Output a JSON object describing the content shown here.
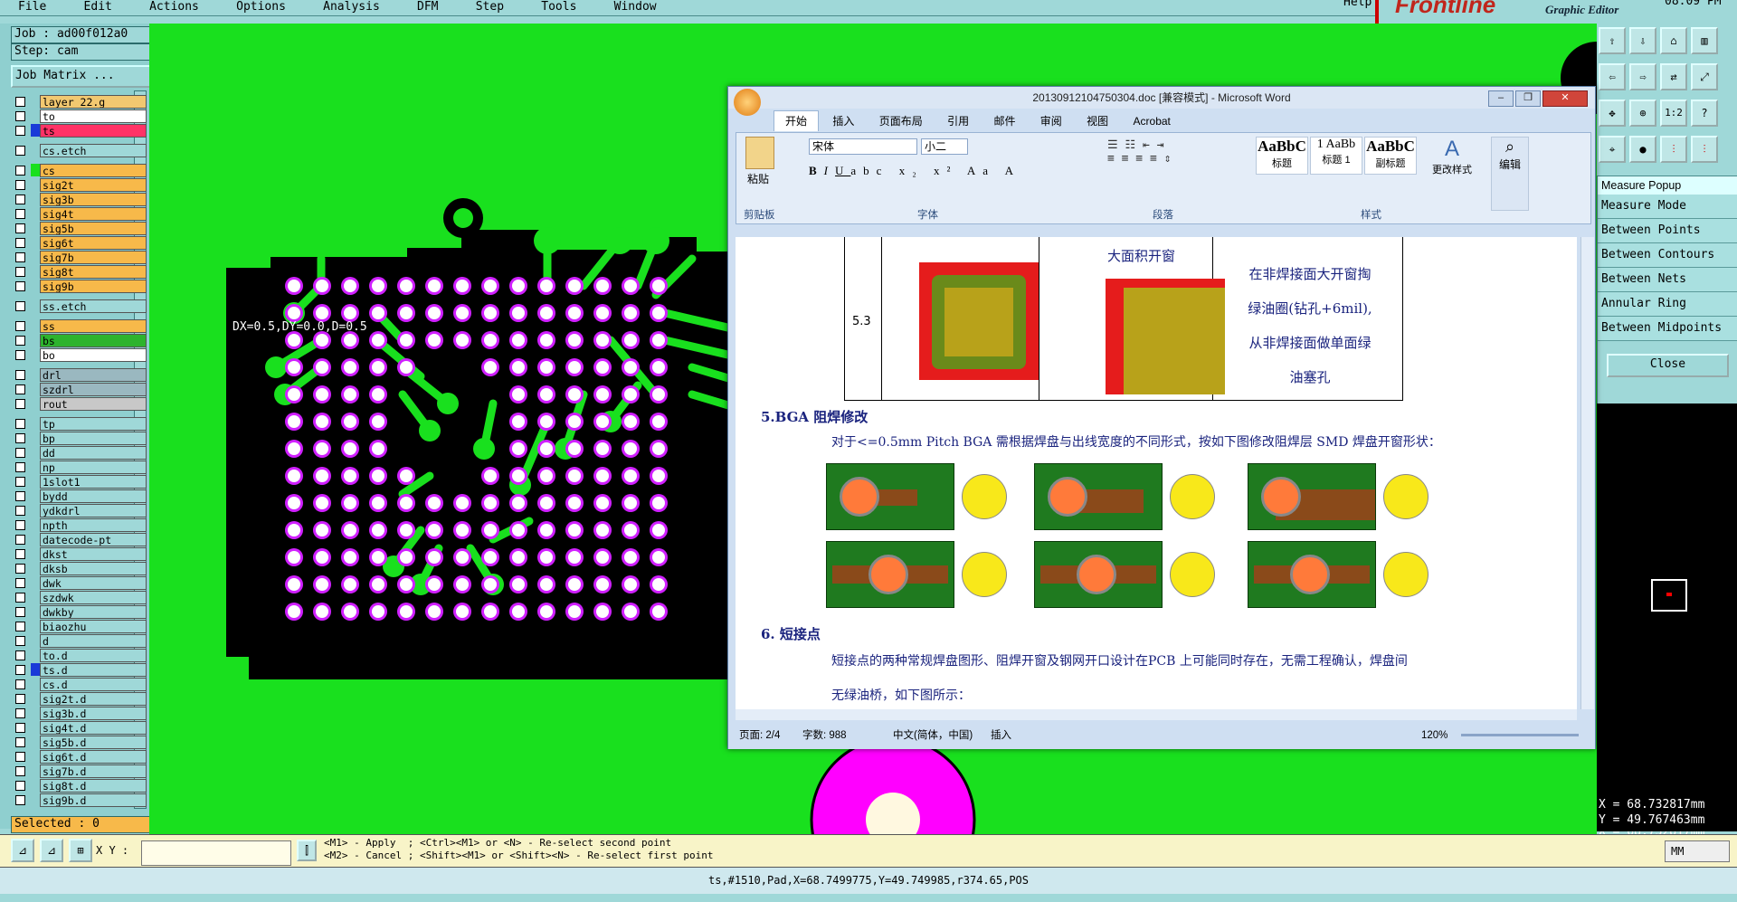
{
  "menu": [
    "File",
    "Edit",
    "Actions",
    "Options",
    "Analysis",
    "DFM",
    "Step",
    "Tools",
    "Window"
  ],
  "help": "Help",
  "brand": {
    "logo": "Frontline",
    "subtitle": "Graphic Editor",
    "clock": "08:09 PM"
  },
  "left": {
    "job": "Job : ad00f012a0",
    "step": "Step: cam",
    "job_matrix": "Job Matrix ...",
    "selected": "Selected : 0"
  },
  "layers": [
    {
      "name": "layer_22.g",
      "color": "#f2c870"
    },
    {
      "name": "to",
      "color": "#ffffff"
    },
    {
      "name": "ts",
      "color": "#ff3366",
      "swatch": "#1a3ad8"
    },
    {
      "gap": true
    },
    {
      "name": "cs.etch",
      "color": "#9fd8d8"
    },
    {
      "gap": true
    },
    {
      "name": "cs",
      "color": "#f7b94a",
      "swatch": "#19e01e"
    },
    {
      "name": "sig2t",
      "color": "#f7b94a"
    },
    {
      "name": "sig3b",
      "color": "#f7b94a"
    },
    {
      "name": "sig4t",
      "color": "#f7b94a"
    },
    {
      "name": "sig5b",
      "color": "#f7b94a"
    },
    {
      "name": "sig6t",
      "color": "#f7b94a"
    },
    {
      "name": "sig7b",
      "color": "#f7b94a"
    },
    {
      "name": "sig8t",
      "color": "#f7b94a"
    },
    {
      "name": "sig9b",
      "color": "#f7b94a"
    },
    {
      "gap": true
    },
    {
      "name": "ss.etch",
      "color": "#9fd8d8"
    },
    {
      "gap": true
    },
    {
      "name": "ss",
      "color": "#f7b94a"
    },
    {
      "name": "bs",
      "color": "#2db32d"
    },
    {
      "name": "bo",
      "color": "#ffffff"
    },
    {
      "gap": true
    },
    {
      "name": "drl",
      "color": "#9ab8c0"
    },
    {
      "name": "szdrl",
      "color": "#9ab8c0"
    },
    {
      "name": "rout",
      "color": "#c8c8c8"
    },
    {
      "gap": true
    },
    {
      "name": "tp",
      "color": "#9fd8d8"
    },
    {
      "name": "bp",
      "color": "#9fd8d8"
    },
    {
      "name": "dd",
      "color": "#9fd8d8"
    },
    {
      "name": "np",
      "color": "#9fd8d8"
    },
    {
      "name": "1slot1",
      "color": "#9fd8d8"
    },
    {
      "name": "bydd",
      "color": "#9fd8d8"
    },
    {
      "name": "ydkdrl",
      "color": "#9fd8d8"
    },
    {
      "name": "npth",
      "color": "#9fd8d8"
    },
    {
      "name": "datecode-pt",
      "color": "#9fd8d8"
    },
    {
      "name": "dkst",
      "color": "#9fd8d8"
    },
    {
      "name": "dksb",
      "color": "#9fd8d8"
    },
    {
      "name": "dwk",
      "color": "#9fd8d8"
    },
    {
      "name": "szdwk",
      "color": "#9fd8d8"
    },
    {
      "name": "dwkby",
      "color": "#9fd8d8"
    },
    {
      "name": "biaozhu",
      "color": "#9fd8d8"
    },
    {
      "name": "d",
      "color": "#9fd8d8"
    },
    {
      "name": "to.d",
      "color": "#9fd8d8"
    },
    {
      "name": "ts.d",
      "color": "#9fd8d8",
      "swatch": "#1a3ad8"
    },
    {
      "name": "cs.d",
      "color": "#9fd8d8"
    },
    {
      "name": "sig2t.d",
      "color": "#9fd8d8"
    },
    {
      "name": "sig3b.d",
      "color": "#9fd8d8"
    },
    {
      "name": "sig4t.d",
      "color": "#9fd8d8"
    },
    {
      "name": "sig5b.d",
      "color": "#9fd8d8"
    },
    {
      "name": "sig6t.d",
      "color": "#9fd8d8"
    },
    {
      "name": "sig7b.d",
      "color": "#9fd8d8"
    },
    {
      "name": "sig8t.d",
      "color": "#9fd8d8"
    },
    {
      "name": "sig9b.d",
      "color": "#9fd8d8"
    }
  ],
  "canvas": {
    "measure_text": "DX=0.5,DY=0.0,D=0.5"
  },
  "measure_popup": {
    "title": "Measure Popup",
    "items": [
      "Measure Mode",
      "Between Points",
      "Between Contours",
      "Between Nets",
      "Annular Ring",
      "Between Midpoints"
    ],
    "close": "Close"
  },
  "coords": {
    "x": "X = 68.732817mm",
    "y": "Y = 49.767463mm"
  },
  "bottom": {
    "xy_label": "X Y :",
    "xy_value": "",
    "hint1": "<M1> - Apply  ; <Ctrl><M1> or <N> - Re-select second point",
    "hint2": "<M2> - Cancel ; <Shift><M1> or <Shift><N> - Re-select first point",
    "units": "MM",
    "status": "ts,#1510,Pad,X=68.7499775,Y=49.749985,r374.65,POS"
  },
  "word": {
    "title": "20130912104750304.doc [兼容模式] - Microsoft Word",
    "tabs": [
      "开始",
      "插入",
      "页面布局",
      "引用",
      "邮件",
      "审阅",
      "视图",
      "Acrobat"
    ],
    "font_name": "宋体",
    "font_size": "小二",
    "groups": [
      "剪贴板",
      "字体",
      "段落",
      "样式"
    ],
    "paste": "粘贴",
    "styles": [
      {
        "sample": "AaBbC",
        "label": "标题"
      },
      {
        "sample": "1 AaBb",
        "label": "标题 1"
      },
      {
        "sample": "AaBbC",
        "label": "副标题"
      }
    ],
    "change_style": "更改样式",
    "edit": "编辑",
    "doc": {
      "row_num": "5.3",
      "cell_big": "大面积开窗",
      "cell_note": [
        "在非焊接面大开窗掏",
        "绿油圈(钻孔+6mil),",
        "从非焊接面做单面绿",
        "油塞孔"
      ],
      "h5": "5.BGA 阻焊修改",
      "p5": "对于<=0.5mm Pitch BGA 需根据焊盘与出线宽度的不同形式，按如下图修改阻焊层 SMD 焊盘开窗形状：",
      "h6": "6.  短接点",
      "p6a": "短接点的两种常规焊盘图形、阻焊开窗及钢网开口设计在PCB 上可能同时存在，无需工程确认，焊盘间",
      "p6b": "无绿油桥，如下图所示："
    },
    "status": {
      "page": "页面: 2/4",
      "words": "字数: 988",
      "lang": "中文(简体，中国)",
      "mode": "插入",
      "zoom": "120%"
    }
  }
}
